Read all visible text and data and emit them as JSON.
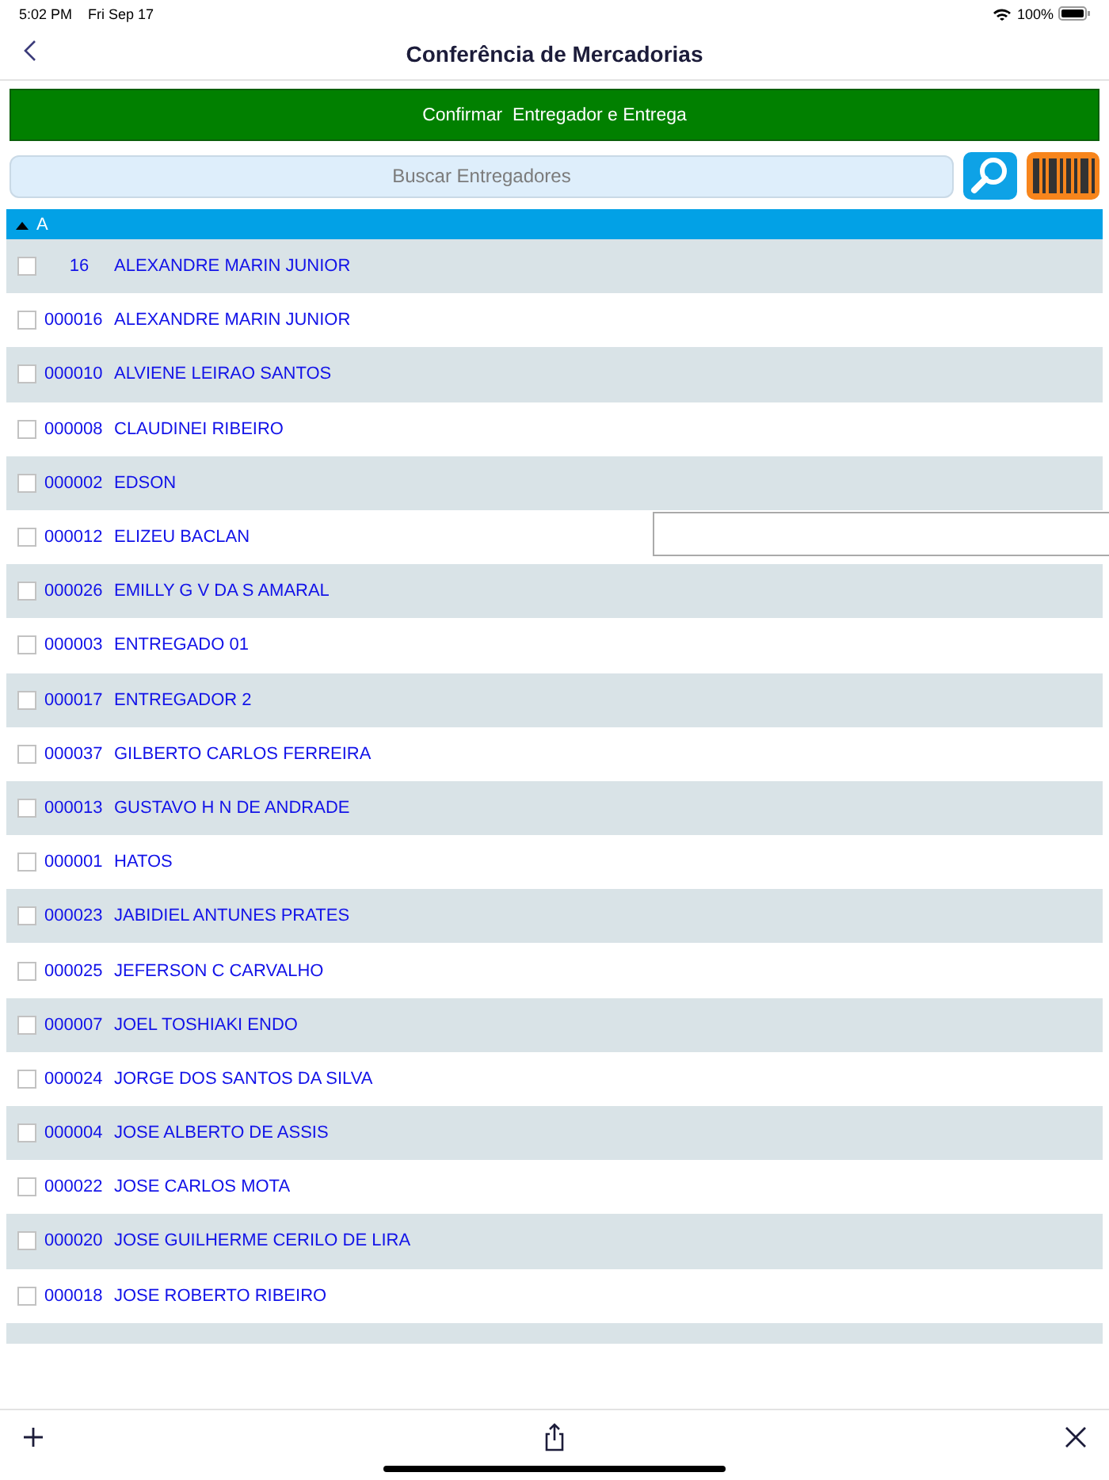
{
  "status_bar": {
    "time": "5:02 PM",
    "date": "Fri Sep 17",
    "battery": "100%"
  },
  "nav": {
    "title": "Conferência de Mercadorias"
  },
  "confirm_button": "Confirmar  Entregador e Entrega",
  "search": {
    "placeholder": "Buscar Entregadores"
  },
  "section": {
    "label": "A",
    "expanded": true
  },
  "rows": [
    {
      "code": "16",
      "name": "ALEXANDRE MARIN JUNIOR",
      "checked": false
    },
    {
      "code": "000016",
      "name": "ALEXANDRE MARIN JUNIOR",
      "checked": false
    },
    {
      "code": "000010",
      "name": "ALVIENE LEIRAO SANTOS",
      "checked": false
    },
    {
      "code": "000008",
      "name": "CLAUDINEI RIBEIRO",
      "checked": false
    },
    {
      "code": "000002",
      "name": "EDSON",
      "checked": false
    },
    {
      "code": "000012",
      "name": "ELIZEU BACLAN",
      "checked": false
    },
    {
      "code": "000026",
      "name": "EMILLY G V DA S AMARAL",
      "checked": false
    },
    {
      "code": "000003",
      "name": "ENTREGADO 01",
      "checked": false
    },
    {
      "code": "000017",
      "name": "ENTREGADOR 2",
      "checked": false
    },
    {
      "code": "000037",
      "name": "GILBERTO CARLOS FERREIRA",
      "checked": false
    },
    {
      "code": "000013",
      "name": "GUSTAVO H N DE ANDRADE",
      "checked": false
    },
    {
      "code": "000001",
      "name": "HATOS",
      "checked": false
    },
    {
      "code": "000023",
      "name": "JABIDIEL ANTUNES PRATES",
      "checked": false
    },
    {
      "code": "000025",
      "name": "JEFERSON C CARVALHO",
      "checked": false
    },
    {
      "code": "000007",
      "name": "JOEL TOSHIAKI ENDO",
      "checked": false
    },
    {
      "code": "000024",
      "name": "JORGE DOS SANTOS DA SILVA",
      "checked": false
    },
    {
      "code": "000004",
      "name": "JOSE ALBERTO DE ASSIS",
      "checked": false
    },
    {
      "code": "000022",
      "name": "JOSE CARLOS MOTA",
      "checked": false
    },
    {
      "code": "000020",
      "name": "JOSE GUILHERME CERILO DE LIRA",
      "checked": false
    },
    {
      "code": "000018",
      "name": "JOSE ROBERTO RIBEIRO",
      "checked": false
    }
  ]
}
